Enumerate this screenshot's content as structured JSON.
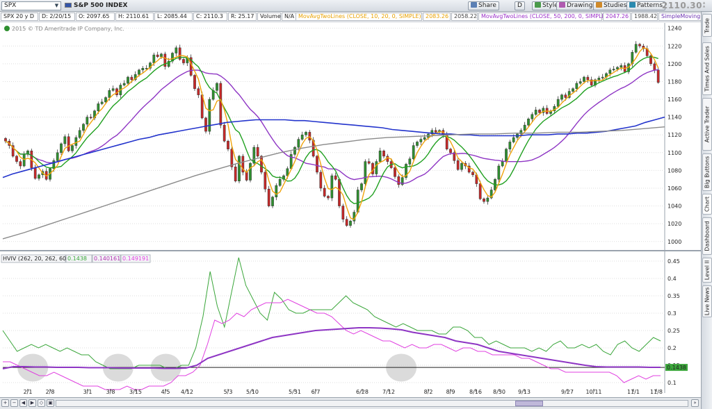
{
  "toolbar": {
    "symbol": "SPX",
    "description": "S&P 500 INDEX",
    "buttons": [
      {
        "label": "Share",
        "icon": "share-icon",
        "x": 673
      },
      {
        "label": "D",
        "icon": "",
        "x": 740
      },
      {
        "label": "Style",
        "icon": "style-icon",
        "x": 765
      },
      {
        "label": "Drawings",
        "icon": "drawings-icon",
        "x": 800
      },
      {
        "label": "Studies",
        "icon": "studies-icon",
        "x": 853
      },
      {
        "label": "Patterns",
        "icon": "patterns-icon",
        "x": 901
      }
    ],
    "last_price": "2110.30"
  },
  "infobar": {
    "fields": [
      "SPX 20 y D",
      "D: 2/20/15",
      "O: 2097.65",
      "H: 2110.61",
      "L: 2085.44",
      "C: 2110.3",
      "R: 25.17",
      "Volume",
      "N/A"
    ],
    "studies": [
      {
        "label": "MovAvgTwoLines (CLOSE, 10, 20, 0, SIMPLE)",
        "v1": "2083.26",
        "v2": "2058.22",
        "color": "#e8a100"
      },
      {
        "label": "MovAvgTwoLines (CLOSE, 50, 200, 0, SIMPLE)",
        "v1": "2047.26",
        "v2": "1988.42",
        "color": "#9b30c8"
      },
      {
        "label": "SimpleMoving...",
        "color": "#6a2fb0"
      }
    ],
    "copyright": "2015 © TD Ameritrade IP Company, Inc."
  },
  "sidebar": {
    "tabs": [
      "Trade",
      "Times And Sales",
      "Active Trader",
      "Big Buttons",
      "Chart",
      "Dashboard",
      "Level II",
      "Live News"
    ]
  },
  "lower_legend": {
    "title": "HVIV (262, 20, 262, 60)",
    "v1": "0.1438",
    "v2": "0.140161",
    "v3": "0.149191"
  },
  "colors": {
    "up_candle": "#2f8f2f",
    "down_candle": "#c62828",
    "ma_fast": "#f0a30a",
    "ma_slow": "#20a020",
    "ma_50": "#8e35c4",
    "ma_200": "#2233cc",
    "sma_long": "#8a8a8a",
    "hv_line": "#3aa63a",
    "iv_line": "#e040e0",
    "iv_avg": "#8e35c4"
  },
  "chart_data": [
    {
      "type": "candlestick",
      "title": "SPX 20 y D",
      "x_tick_labels": [
        "2/1",
        "2/8",
        "3/1",
        "3/8",
        "3/15",
        "4/5",
        "4/12",
        "5/3",
        "5/10",
        "5/31",
        "6/7",
        "6/28",
        "7/12",
        "8/2",
        "8/9",
        "8/16",
        "8/30",
        "9/13",
        "9/27",
        "10/11",
        "11/1",
        "11/8"
      ],
      "y_ticks": [
        1000,
        1020,
        1040,
        1060,
        1080,
        1100,
        1120,
        1140,
        1160,
        1180,
        1200,
        1220,
        1240
      ],
      "ylim": [
        992,
        1246
      ],
      "close_points": [
        1113,
        1108,
        1096,
        1090,
        1085,
        1098,
        1102,
        1083,
        1071,
        1075,
        1079,
        1070,
        1082,
        1091,
        1100,
        1110,
        1118,
        1102,
        1108,
        1117,
        1125,
        1132,
        1140,
        1139,
        1147,
        1155,
        1157,
        1162,
        1170,
        1172,
        1165,
        1176,
        1178,
        1185,
        1182,
        1188,
        1193,
        1195,
        1195,
        1201,
        1210,
        1208,
        1211,
        1197,
        1203,
        1212,
        1218,
        1205,
        1201,
        1207,
        1187,
        1172,
        1165,
        1139,
        1124,
        1160,
        1170,
        1178,
        1131,
        1113,
        1104,
        1084,
        1068,
        1096,
        1078,
        1069,
        1088,
        1106,
        1096,
        1078,
        1059,
        1040,
        1050,
        1063,
        1070,
        1074,
        1082,
        1098,
        1106,
        1115,
        1120,
        1123,
        1114,
        1096,
        1078,
        1060,
        1051,
        1049,
        1074,
        1070,
        1040,
        1025,
        1018,
        1023,
        1033,
        1058,
        1065,
        1090,
        1088,
        1076,
        1090,
        1102,
        1096,
        1090,
        1083,
        1073,
        1064,
        1072,
        1087,
        1093,
        1108,
        1112,
        1115,
        1117,
        1121,
        1125,
        1123,
        1125,
        1120,
        1104,
        1100,
        1091,
        1081,
        1088,
        1085,
        1078,
        1075,
        1065,
        1048,
        1045,
        1049,
        1058,
        1070,
        1085,
        1090,
        1104,
        1112,
        1117,
        1121,
        1125,
        1131,
        1138,
        1143,
        1148,
        1145,
        1150,
        1144,
        1147,
        1152,
        1160,
        1165,
        1162,
        1169,
        1172,
        1178,
        1180,
        1185,
        1182,
        1176,
        1182,
        1184,
        1185,
        1189,
        1193,
        1194,
        1196,
        1198,
        1191,
        1200,
        1213,
        1222,
        1220,
        1217,
        1209,
        1200,
        1193,
        1179
      ],
      "series": [
        {
          "name": "MovAvg 10",
          "values_ref": "computed-from-close"
        },
        {
          "name": "MovAvg 20",
          "values_ref": "computed-from-close"
        },
        {
          "name": "MovAvg 50",
          "values_ref": "computed-from-close"
        },
        {
          "name": "MovAvg 200",
          "values_ref": "computed-from-close"
        }
      ],
      "ma_200_values": [
        1072,
        1076,
        1079,
        1082,
        1085,
        1088,
        1091,
        1094,
        1097,
        1100,
        1103,
        1106,
        1109,
        1112,
        1115,
        1117,
        1120,
        1122,
        1124,
        1126,
        1128,
        1130,
        1132,
        1134,
        1135,
        1136,
        1137,
        1137,
        1137,
        1137,
        1136,
        1136,
        1135,
        1134,
        1133,
        1132,
        1131,
        1130,
        1129,
        1128,
        1126,
        1125,
        1124,
        1123,
        1122,
        1121,
        1121,
        1120,
        1120,
        1119,
        1119,
        1119,
        1119,
        1119,
        1120,
        1120,
        1120,
        1121,
        1121,
        1122,
        1122,
        1123,
        1124,
        1126,
        1128,
        1130,
        1134,
        1137,
        1140
      ],
      "ma_long_values": [
        1003,
        1010,
        1018,
        1026,
        1034,
        1042,
        1050,
        1058,
        1066,
        1074,
        1081,
        1088,
        1094,
        1100,
        1105,
        1109,
        1112,
        1115,
        1117,
        1118,
        1119,
        1120,
        1121,
        1121,
        1122,
        1122,
        1123,
        1123,
        1124,
        1125,
        1127,
        1129
      ]
    },
    {
      "type": "line",
      "title": "HVIV (262, 20, 262, 60)",
      "y_ticks": [
        0.1,
        0.15,
        0.2,
        0.25,
        0.3,
        0.35,
        0.4,
        0.45
      ],
      "ylim": [
        0.07,
        0.47
      ],
      "reference_line": 0.1438,
      "series": [
        {
          "name": "HV",
          "values": [
            0.25,
            0.22,
            0.19,
            0.2,
            0.21,
            0.2,
            0.21,
            0.2,
            0.19,
            0.2,
            0.19,
            0.18,
            0.18,
            0.16,
            0.15,
            0.14,
            0.14,
            0.14,
            0.14,
            0.15,
            0.15,
            0.15,
            0.15,
            0.14,
            0.14,
            0.15,
            0.15,
            0.2,
            0.29,
            0.42,
            0.32,
            0.26,
            0.36,
            0.46,
            0.38,
            0.34,
            0.3,
            0.28,
            0.36,
            0.34,
            0.31,
            0.3,
            0.3,
            0.31,
            0.31,
            0.31,
            0.31,
            0.33,
            0.35,
            0.33,
            0.32,
            0.31,
            0.29,
            0.28,
            0.27,
            0.26,
            0.27,
            0.26,
            0.25,
            0.25,
            0.25,
            0.24,
            0.24,
            0.26,
            0.26,
            0.25,
            0.23,
            0.23,
            0.21,
            0.22,
            0.21,
            0.2,
            0.2,
            0.2,
            0.19,
            0.2,
            0.19,
            0.21,
            0.22,
            0.2,
            0.2,
            0.21,
            0.2,
            0.21,
            0.19,
            0.18,
            0.21,
            0.22,
            0.2,
            0.19,
            0.21,
            0.23,
            0.22
          ]
        },
        {
          "name": "IV",
          "values": [
            0.16,
            0.16,
            0.15,
            0.14,
            0.13,
            0.12,
            0.12,
            0.13,
            0.12,
            0.11,
            0.1,
            0.09,
            0.09,
            0.09,
            0.08,
            0.08,
            0.08,
            0.09,
            0.08,
            0.08,
            0.09,
            0.09,
            0.09,
            0.1,
            0.12,
            0.12,
            0.13,
            0.15,
            0.21,
            0.28,
            0.27,
            0.28,
            0.3,
            0.29,
            0.31,
            0.32,
            0.33,
            0.33,
            0.33,
            0.34,
            0.33,
            0.32,
            0.31,
            0.3,
            0.3,
            0.29,
            0.27,
            0.25,
            0.24,
            0.25,
            0.24,
            0.23,
            0.22,
            0.22,
            0.21,
            0.2,
            0.21,
            0.2,
            0.2,
            0.21,
            0.21,
            0.2,
            0.19,
            0.2,
            0.2,
            0.19,
            0.19,
            0.18,
            0.18,
            0.18,
            0.18,
            0.17,
            0.17,
            0.16,
            0.15,
            0.14,
            0.14,
            0.13,
            0.13,
            0.13,
            0.13,
            0.13,
            0.13,
            0.13,
            0.12,
            0.1,
            0.11,
            0.12,
            0.11,
            0.12,
            0.12
          ]
        },
        {
          "name": "IV avg",
          "values": [
            0.14,
            0.146,
            0.146,
            0.145,
            0.145,
            0.144,
            0.144,
            0.144,
            0.143,
            0.143,
            0.143,
            0.142,
            0.142,
            0.142,
            0.142,
            0.141,
            0.141,
            0.142,
            0.15,
            0.17,
            0.18,
            0.19,
            0.2,
            0.21,
            0.22,
            0.23,
            0.235,
            0.24,
            0.245,
            0.25,
            0.252,
            0.254,
            0.256,
            0.258,
            0.258,
            0.257,
            0.255,
            0.252,
            0.245,
            0.24,
            0.235,
            0.23,
            0.22,
            0.215,
            0.21,
            0.2,
            0.19,
            0.185,
            0.18,
            0.175,
            0.17,
            0.165,
            0.16,
            0.155,
            0.15,
            0.146,
            0.145,
            0.145,
            0.145,
            0.145,
            0.144,
            0.144
          ]
        }
      ],
      "highlight_circles": [
        {
          "x_index": 2
        },
        {
          "x_index": 27
        },
        {
          "x_index": 41
        },
        {
          "x_index": 110
        }
      ]
    }
  ]
}
